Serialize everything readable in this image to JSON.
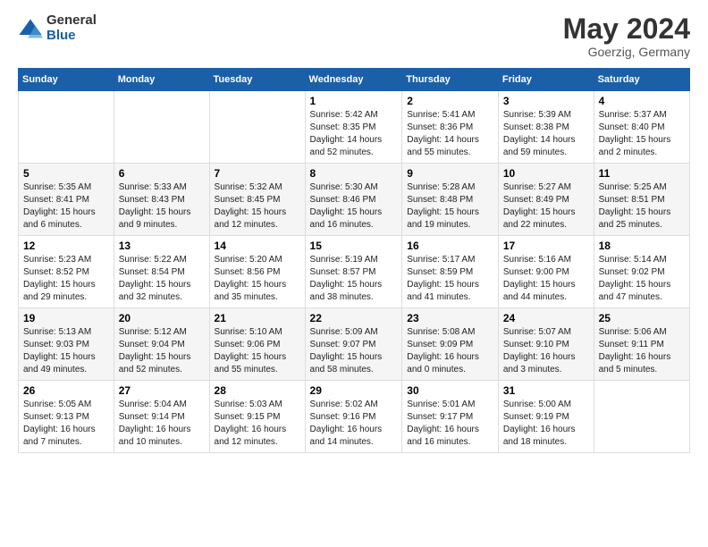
{
  "logo": {
    "general": "General",
    "blue": "Blue"
  },
  "title": {
    "month_year": "May 2024",
    "location": "Goerzig, Germany"
  },
  "days_of_week": [
    "Sunday",
    "Monday",
    "Tuesday",
    "Wednesday",
    "Thursday",
    "Friday",
    "Saturday"
  ],
  "weeks": [
    [
      {
        "day": "",
        "info": ""
      },
      {
        "day": "",
        "info": ""
      },
      {
        "day": "",
        "info": ""
      },
      {
        "day": "1",
        "info": "Sunrise: 5:42 AM\nSunset: 8:35 PM\nDaylight: 14 hours and 52 minutes."
      },
      {
        "day": "2",
        "info": "Sunrise: 5:41 AM\nSunset: 8:36 PM\nDaylight: 14 hours and 55 minutes."
      },
      {
        "day": "3",
        "info": "Sunrise: 5:39 AM\nSunset: 8:38 PM\nDaylight: 14 hours and 59 minutes."
      },
      {
        "day": "4",
        "info": "Sunrise: 5:37 AM\nSunset: 8:40 PM\nDaylight: 15 hours and 2 minutes."
      }
    ],
    [
      {
        "day": "5",
        "info": "Sunrise: 5:35 AM\nSunset: 8:41 PM\nDaylight: 15 hours and 6 minutes."
      },
      {
        "day": "6",
        "info": "Sunrise: 5:33 AM\nSunset: 8:43 PM\nDaylight: 15 hours and 9 minutes."
      },
      {
        "day": "7",
        "info": "Sunrise: 5:32 AM\nSunset: 8:45 PM\nDaylight: 15 hours and 12 minutes."
      },
      {
        "day": "8",
        "info": "Sunrise: 5:30 AM\nSunset: 8:46 PM\nDaylight: 15 hours and 16 minutes."
      },
      {
        "day": "9",
        "info": "Sunrise: 5:28 AM\nSunset: 8:48 PM\nDaylight: 15 hours and 19 minutes."
      },
      {
        "day": "10",
        "info": "Sunrise: 5:27 AM\nSunset: 8:49 PM\nDaylight: 15 hours and 22 minutes."
      },
      {
        "day": "11",
        "info": "Sunrise: 5:25 AM\nSunset: 8:51 PM\nDaylight: 15 hours and 25 minutes."
      }
    ],
    [
      {
        "day": "12",
        "info": "Sunrise: 5:23 AM\nSunset: 8:52 PM\nDaylight: 15 hours and 29 minutes."
      },
      {
        "day": "13",
        "info": "Sunrise: 5:22 AM\nSunset: 8:54 PM\nDaylight: 15 hours and 32 minutes."
      },
      {
        "day": "14",
        "info": "Sunrise: 5:20 AM\nSunset: 8:56 PM\nDaylight: 15 hours and 35 minutes."
      },
      {
        "day": "15",
        "info": "Sunrise: 5:19 AM\nSunset: 8:57 PM\nDaylight: 15 hours and 38 minutes."
      },
      {
        "day": "16",
        "info": "Sunrise: 5:17 AM\nSunset: 8:59 PM\nDaylight: 15 hours and 41 minutes."
      },
      {
        "day": "17",
        "info": "Sunrise: 5:16 AM\nSunset: 9:00 PM\nDaylight: 15 hours and 44 minutes."
      },
      {
        "day": "18",
        "info": "Sunrise: 5:14 AM\nSunset: 9:02 PM\nDaylight: 15 hours and 47 minutes."
      }
    ],
    [
      {
        "day": "19",
        "info": "Sunrise: 5:13 AM\nSunset: 9:03 PM\nDaylight: 15 hours and 49 minutes."
      },
      {
        "day": "20",
        "info": "Sunrise: 5:12 AM\nSunset: 9:04 PM\nDaylight: 15 hours and 52 minutes."
      },
      {
        "day": "21",
        "info": "Sunrise: 5:10 AM\nSunset: 9:06 PM\nDaylight: 15 hours and 55 minutes."
      },
      {
        "day": "22",
        "info": "Sunrise: 5:09 AM\nSunset: 9:07 PM\nDaylight: 15 hours and 58 minutes."
      },
      {
        "day": "23",
        "info": "Sunrise: 5:08 AM\nSunset: 9:09 PM\nDaylight: 16 hours and 0 minutes."
      },
      {
        "day": "24",
        "info": "Sunrise: 5:07 AM\nSunset: 9:10 PM\nDaylight: 16 hours and 3 minutes."
      },
      {
        "day": "25",
        "info": "Sunrise: 5:06 AM\nSunset: 9:11 PM\nDaylight: 16 hours and 5 minutes."
      }
    ],
    [
      {
        "day": "26",
        "info": "Sunrise: 5:05 AM\nSunset: 9:13 PM\nDaylight: 16 hours and 7 minutes."
      },
      {
        "day": "27",
        "info": "Sunrise: 5:04 AM\nSunset: 9:14 PM\nDaylight: 16 hours and 10 minutes."
      },
      {
        "day": "28",
        "info": "Sunrise: 5:03 AM\nSunset: 9:15 PM\nDaylight: 16 hours and 12 minutes."
      },
      {
        "day": "29",
        "info": "Sunrise: 5:02 AM\nSunset: 9:16 PM\nDaylight: 16 hours and 14 minutes."
      },
      {
        "day": "30",
        "info": "Sunrise: 5:01 AM\nSunset: 9:17 PM\nDaylight: 16 hours and 16 minutes."
      },
      {
        "day": "31",
        "info": "Sunrise: 5:00 AM\nSunset: 9:19 PM\nDaylight: 16 hours and 18 minutes."
      },
      {
        "day": "",
        "info": ""
      }
    ]
  ]
}
